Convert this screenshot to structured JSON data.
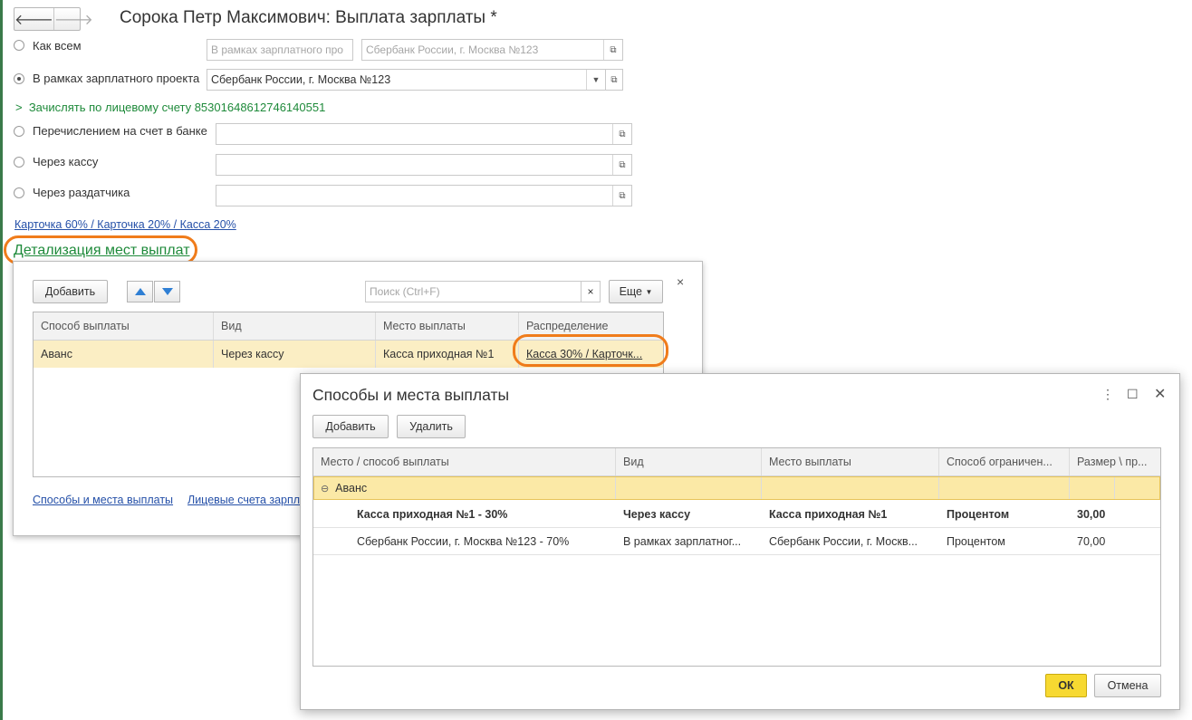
{
  "title": "Сорока Петр Максимович: Выплата зарплаты *",
  "nav": {
    "back": "🡐",
    "forward": "🡒"
  },
  "options": {
    "like_all": "Как всем",
    "salary_project": "В рамках зарплатного проекта",
    "bank_transfer": "Перечислением на счет в банке",
    "cash_desk": "Через кассу",
    "distributor": "Через раздатчика"
  },
  "fields": {
    "like_all_project": "В рамках зарплатного про",
    "like_all_bank": "Сбербанк России, г. Москва №123",
    "salary_bank": "Сбербанк России, г. Москва №123",
    "bank_account": "",
    "cash": "",
    "distributor": ""
  },
  "account_link": "Зачислять по лицевому счету 85301648612746140551",
  "distribution_link": "Карточка 60% / Карточка 20% / Касса 20%",
  "detail_link": "Детализация мест выплат",
  "popup1": {
    "add": "Добавить",
    "search_placeholder": "Поиск (Ctrl+F)",
    "more": "Еще",
    "columns": [
      "Способ выплаты",
      "Вид",
      "Место выплаты",
      "Распределение"
    ],
    "rows": [
      {
        "method": "Аванс",
        "kind": "Через кассу",
        "place": "Касса приходная №1",
        "distribution": "Касса 30% / Карточк..."
      }
    ],
    "links": {
      "methods": "Способы и места выплаты",
      "accounts": "Лицевые счета зарпл"
    }
  },
  "popup2": {
    "title": "Способы и места выплаты",
    "add": "Добавить",
    "delete": "Удалить",
    "columns": [
      "Место / способ выплаты",
      "Вид",
      "Место выплаты",
      "Способ ограничен...",
      "Размер \\ пр..."
    ],
    "group": "Аванс",
    "rows": [
      {
        "name": "Касса приходная №1 - 30%",
        "kind": "Через кассу",
        "place": "Касса приходная №1",
        "limit": "Процентом",
        "size": "30,00",
        "bold": true
      },
      {
        "name": "Сбербанк России, г. Москва №123 - 70%",
        "kind": "В рамках зарплатног...",
        "place": "Сбербанк России, г. Москв...",
        "limit": "Процентом",
        "size": "70,00",
        "bold": false
      }
    ],
    "ok": "ОК",
    "cancel": "Отмена"
  },
  "colors": {
    "accent_green": "#1e8a3a",
    "highlight_orange": "#f07c1b",
    "selected_row": "#fbeec4",
    "ok_yellow": "#f7d931"
  }
}
